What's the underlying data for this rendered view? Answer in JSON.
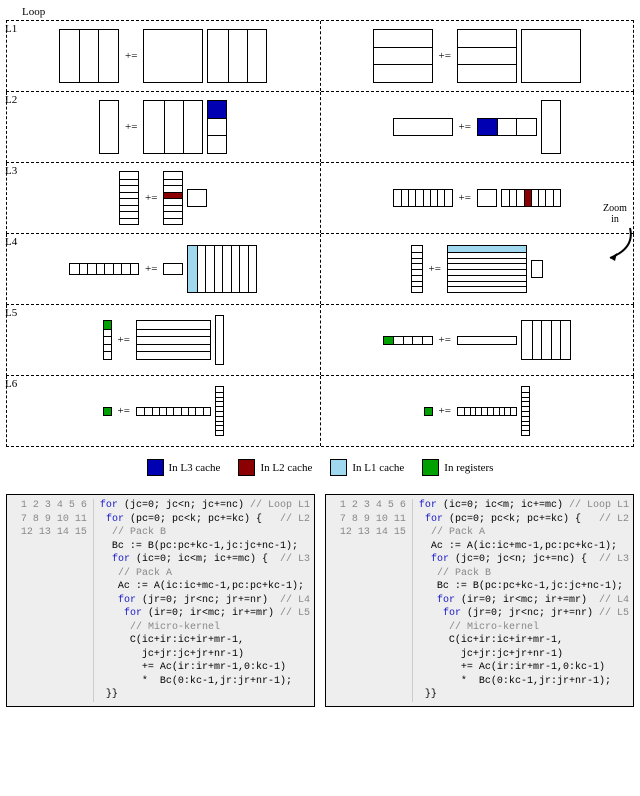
{
  "title": "Loop",
  "rows": [
    "L1",
    "L2",
    "L3",
    "L4",
    "L5",
    "L6"
  ],
  "symbol": "+=",
  "zoom": "Zoom\nin",
  "legend": {
    "l3": "In L3 cache",
    "l2": "In L2 cache",
    "l1": "In L1 cache",
    "reg": "In registers"
  },
  "codeA": {
    "lines": [
      {
        "n": 1,
        "parts": [
          [
            "kw",
            "for"
          ],
          [
            "",
            " (jc=0; jc<n; jc+=nc) "
          ],
          [
            "cm",
            "// Loop L1"
          ]
        ]
      },
      {
        "n": 2,
        "parts": [
          [
            "",
            " "
          ],
          [
            "kw",
            "for"
          ],
          [
            "",
            " (pc=0; pc<k; pc+=kc) {   "
          ],
          [
            "cm",
            "// L2"
          ]
        ]
      },
      {
        "n": 3,
        "parts": [
          [
            "",
            "  "
          ],
          [
            "cm",
            "// Pack B"
          ]
        ]
      },
      {
        "n": 4,
        "parts": [
          [
            "",
            "  Bc := B(pc:pc+kc-1,jc:jc+nc-1);"
          ]
        ]
      },
      {
        "n": 5,
        "parts": [
          [
            "",
            "  "
          ],
          [
            "kw",
            "for"
          ],
          [
            "",
            " (ic=0; ic<m; ic+=mc) {  "
          ],
          [
            "cm",
            "// L3"
          ]
        ]
      },
      {
        "n": 6,
        "parts": [
          [
            "",
            "   "
          ],
          [
            "cm",
            "// Pack A"
          ]
        ]
      },
      {
        "n": 7,
        "parts": [
          [
            "",
            "   Ac := A(ic:ic+mc-1,pc:pc+kc-1);"
          ]
        ]
      },
      {
        "n": 8,
        "parts": [
          [
            "",
            "   "
          ],
          [
            "kw",
            "for"
          ],
          [
            "",
            " (jr=0; jr<nc; jr+=nr)  "
          ],
          [
            "cm",
            "// L4"
          ]
        ]
      },
      {
        "n": 9,
        "parts": [
          [
            "",
            "    "
          ],
          [
            "kw",
            "for"
          ],
          [
            "",
            " (ir=0; ir<mc; ir+=mr) "
          ],
          [
            "cm",
            "// L5"
          ]
        ]
      },
      {
        "n": 10,
        "parts": [
          [
            "",
            "     "
          ],
          [
            "cm",
            "// Micro-kernel"
          ]
        ]
      },
      {
        "n": 11,
        "parts": [
          [
            "",
            "     C(ic+ir:ic+ir+mr-1,"
          ]
        ]
      },
      {
        "n": 12,
        "parts": [
          [
            "",
            "       jc+jr:jc+jr+nr-1)"
          ]
        ]
      },
      {
        "n": 13,
        "parts": [
          [
            "",
            "       += Ac(ir:ir+mr-1,0:kc-1)"
          ]
        ]
      },
      {
        "n": 14,
        "parts": [
          [
            "",
            "       *  Bc(0:kc-1,jr:jr+nr-1);"
          ]
        ]
      },
      {
        "n": 15,
        "parts": [
          [
            "",
            " }}"
          ]
        ]
      }
    ]
  },
  "codeB": {
    "lines": [
      {
        "n": 1,
        "parts": [
          [
            "kw",
            "for"
          ],
          [
            "",
            " (ic=0; ic<m; ic+=mc) "
          ],
          [
            "cm",
            "// Loop L1"
          ]
        ]
      },
      {
        "n": 2,
        "parts": [
          [
            "",
            " "
          ],
          [
            "kw",
            "for"
          ],
          [
            "",
            " (pc=0; pc<k; pc+=kc) {   "
          ],
          [
            "cm",
            "// L2"
          ]
        ]
      },
      {
        "n": 3,
        "parts": [
          [
            "",
            "  "
          ],
          [
            "cm",
            "// Pack A"
          ]
        ]
      },
      {
        "n": 4,
        "parts": [
          [
            "",
            "  Ac := A(ic:ic+mc-1,pc:pc+kc-1);"
          ]
        ]
      },
      {
        "n": 5,
        "parts": [
          [
            "",
            "  "
          ],
          [
            "kw",
            "for"
          ],
          [
            "",
            " (jc=0; jc<n; jc+=nc) {  "
          ],
          [
            "cm",
            "// L3"
          ]
        ]
      },
      {
        "n": 6,
        "parts": [
          [
            "",
            "   "
          ],
          [
            "cm",
            "// Pack B"
          ]
        ]
      },
      {
        "n": 7,
        "parts": [
          [
            "",
            "   Bc := B(pc:pc+kc-1,jc:jc+nc-1);"
          ]
        ]
      },
      {
        "n": 8,
        "parts": [
          [
            "",
            "   "
          ],
          [
            "kw",
            "for"
          ],
          [
            "",
            " (ir=0; ir<mc; ir+=mr)  "
          ],
          [
            "cm",
            "// L4"
          ]
        ]
      },
      {
        "n": 9,
        "parts": [
          [
            "",
            "    "
          ],
          [
            "kw",
            "for"
          ],
          [
            "",
            " (jr=0; jr<nc; jr+=nr) "
          ],
          [
            "cm",
            "// L5"
          ]
        ]
      },
      {
        "n": 10,
        "parts": [
          [
            "",
            "     "
          ],
          [
            "cm",
            "// Micro-kernel"
          ]
        ]
      },
      {
        "n": 11,
        "parts": [
          [
            "",
            "     C(ic+ir:ic+ir+mr-1,"
          ]
        ]
      },
      {
        "n": 12,
        "parts": [
          [
            "",
            "       jc+jr:jc+jr+nr-1)"
          ]
        ]
      },
      {
        "n": 13,
        "parts": [
          [
            "",
            "       += Ac(ir:ir+mr-1,0:kc-1)"
          ]
        ]
      },
      {
        "n": 14,
        "parts": [
          [
            "",
            "       *  Bc(0:kc-1,jr:jr+nr-1);"
          ]
        ]
      },
      {
        "n": 15,
        "parts": [
          [
            "",
            " }}"
          ]
        ]
      }
    ]
  }
}
